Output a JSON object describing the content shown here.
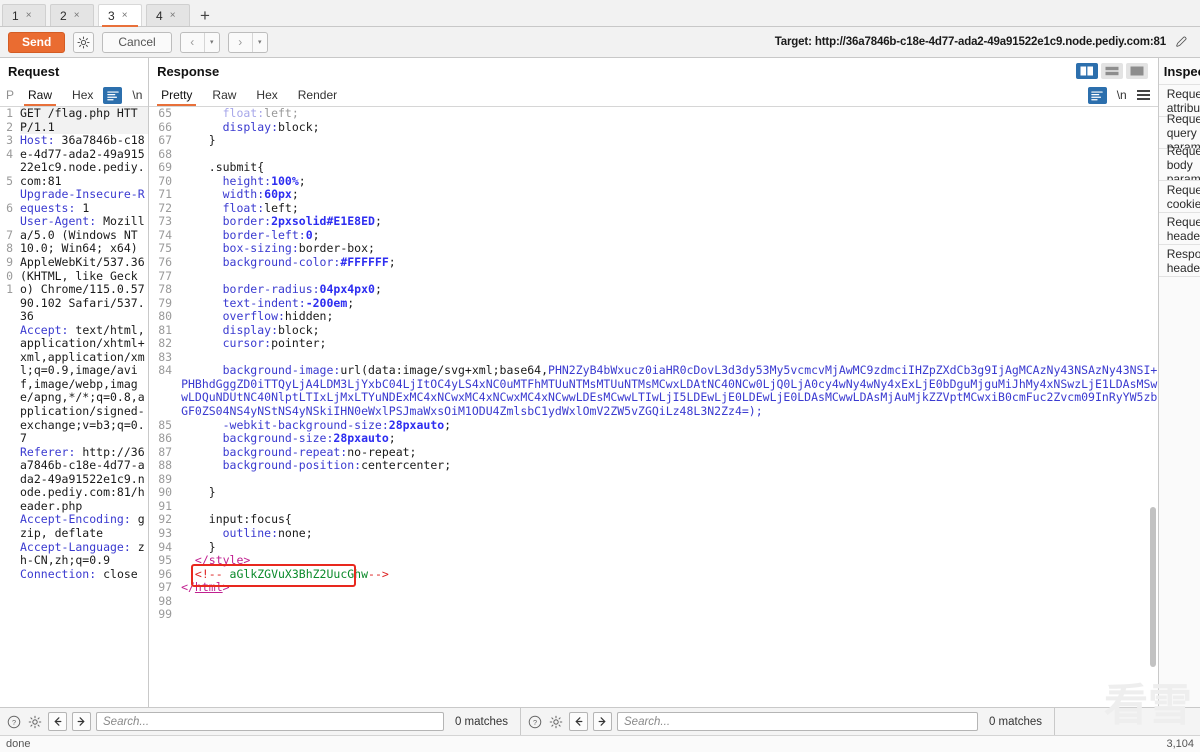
{
  "tabs": {
    "items": [
      {
        "label": "1",
        "close": "×",
        "active": false
      },
      {
        "label": "2",
        "close": "×",
        "active": false
      },
      {
        "label": "3",
        "close": "×",
        "active": true
      },
      {
        "label": "4",
        "close": "×",
        "active": false
      }
    ],
    "add_label": "+"
  },
  "actionbar": {
    "send_label": "Send",
    "settings_icon": "gear-icon",
    "cancel_label": "Cancel",
    "prev_label": "‹",
    "next_label": "›",
    "dropdown_caret": "▾",
    "target_label": "Target: http://36a7846b-c18e-4d77-ada2-49a91522e1c9.node.pediy.com:81",
    "edit_icon": "pencil-icon"
  },
  "request": {
    "title": "Request",
    "tabs": [
      {
        "label": "P",
        "active": false
      },
      {
        "label": "Raw",
        "active": true
      },
      {
        "label": "Hex",
        "active": false
      }
    ],
    "format_icon": "format-icon",
    "newline_label": "\\n",
    "menu_icon": "hamburger-icon",
    "lines": [
      {
        "n": "1",
        "kind": "request-line",
        "method": "GET",
        "path": "/flag.php",
        "version": "HTTP/1.1"
      },
      {
        "n": "2",
        "kind": "header",
        "key": "Host:",
        "value": " 36a7846b-c18e-4d77-ada2-49a91522e1c9.node.pediy.com:81"
      },
      {
        "n": "3",
        "kind": "header",
        "key": "Upgrade-Insecure-Requests:",
        "value": " 1"
      },
      {
        "n": "4",
        "kind": "header",
        "key": "User-Agent:",
        "value": " Mozilla/5.0 (Windows NT 10.0; Win64; x64) AppleWebKit/537.36 (KHTML, like Gecko) Chrome/115.0.5790.102 Safari/537.36"
      },
      {
        "n": "5",
        "kind": "header",
        "key": "Accept:",
        "value": " text/html,application/xhtml+xml,application/xml;q=0.9,image/avif,image/webp,image/apng,*/*;q=0.8,application/signed-exchange;v=b3;q=0.7"
      },
      {
        "n": "6",
        "kind": "header",
        "key": "Referer:",
        "value": " http://36a7846b-c18e-4d77-ada2-49a91522e1c9.node.pediy.com:81/header.php"
      },
      {
        "n": "7",
        "kind": "header",
        "key": "Accept-Encoding:",
        "value": " gzip, deflate"
      },
      {
        "n": "8",
        "kind": "header",
        "key": "Accept-Language:",
        "value": " zh-CN,zh;q=0.9"
      },
      {
        "n": "9",
        "kind": "header",
        "key": "Connection:",
        "value": " close"
      },
      {
        "n": "0",
        "kind": "blank",
        "key": "",
        "value": ""
      },
      {
        "n": "1",
        "kind": "blank",
        "key": "",
        "value": ""
      }
    ],
    "search": {
      "placeholder": "Search...",
      "matches": "0 matches",
      "help_icon": "help-icon",
      "settings_icon": "gear-icon",
      "prev_icon": "arrow-left-icon",
      "next_icon": "arrow-right-icon"
    }
  },
  "response": {
    "title": "Response",
    "tabs": [
      {
        "label": "Pretty",
        "active": true
      },
      {
        "label": "Raw",
        "active": false
      },
      {
        "label": "Hex",
        "active": false
      },
      {
        "label": "Render",
        "active": false
      }
    ],
    "layout_toggles": [
      {
        "name": "split-vertical-icon",
        "active": true
      },
      {
        "name": "split-horizontal-icon",
        "active": false
      },
      {
        "name": "single-pane-icon",
        "active": false
      }
    ],
    "format_icon": "format-icon",
    "newline_label": "\\n",
    "menu_icon": "hamburger-icon",
    "lines": [
      {
        "n": "65",
        "indent": 3,
        "text": "float:left;",
        "prop": "float",
        "value": "left",
        "style": "css",
        "clipped": true
      },
      {
        "n": "66",
        "indent": 3,
        "text": "display:block;",
        "prop": "display",
        "value": "block",
        "style": "css"
      },
      {
        "n": "67",
        "indent": 2,
        "text": "}",
        "style": "plain"
      },
      {
        "n": "68",
        "indent": 0,
        "text": "",
        "style": "plain"
      },
      {
        "n": "69",
        "indent": 2,
        "text": ".submit{",
        "style": "plain"
      },
      {
        "n": "70",
        "indent": 3,
        "text": "height:100%;",
        "prop": "height",
        "value": "100%",
        "style": "cssnum"
      },
      {
        "n": "71",
        "indent": 3,
        "text": "width:60px;",
        "prop": "width",
        "value": "60px",
        "style": "cssnum"
      },
      {
        "n": "72",
        "indent": 3,
        "text": "float:left;",
        "prop": "float",
        "value": "left",
        "style": "css"
      },
      {
        "n": "73",
        "indent": 3,
        "text": "border:2pxsolid#E1E8ED;",
        "prop": "border",
        "value": "2pxsolid#E1E8ED",
        "style": "cssnum"
      },
      {
        "n": "74",
        "indent": 3,
        "text": "border-left:0;",
        "prop": "border-left",
        "value": "0",
        "style": "cssnum"
      },
      {
        "n": "75",
        "indent": 3,
        "text": "box-sizing:border-box;",
        "prop": "box-sizing",
        "value": "border-box",
        "style": "css"
      },
      {
        "n": "76",
        "indent": 3,
        "text": "background-color:#FFFFFF;",
        "prop": "background-color",
        "value": "#FFFFFF",
        "style": "cssnum"
      },
      {
        "n": "77",
        "indent": 0,
        "text": "",
        "style": "plain"
      },
      {
        "n": "78",
        "indent": 3,
        "text": "border-radius:04px4px0;",
        "prop": "border-radius",
        "value": "04px4px0",
        "style": "cssnum"
      },
      {
        "n": "79",
        "indent": 3,
        "text": "text-indent:-200em;",
        "prop": "text-indent",
        "value": "-200em",
        "style": "cssnum"
      },
      {
        "n": "80",
        "indent": 3,
        "text": "overflow:hidden;",
        "prop": "overflow",
        "value": "hidden",
        "style": "css"
      },
      {
        "n": "81",
        "indent": 3,
        "text": "display:block;",
        "prop": "display",
        "value": "block",
        "style": "css"
      },
      {
        "n": "82",
        "indent": 3,
        "text": "cursor:pointer;",
        "prop": "cursor",
        "value": "pointer",
        "style": "css"
      },
      {
        "n": "83",
        "indent": 0,
        "text": "",
        "style": "plain"
      },
      {
        "n": "84",
        "indent": 3,
        "text": "background-image:url(data:image/svg+xml;base64,PHN2ZyB4bWxucz0iaHR0cDovL3d3dy53My5vcmcvMjAwMC9zdmciIHZpZXdCb3g9IjAgMCAzNy43NSAzNy43NSI+PHBhdGggZD0iTTQyLjA4LDM3LjYxbC04LjItOC4yLS4xNC0uMTFhMTUuNTMsMTUuNTMsMCwxLDAtNC40NCw0LjQ0LjA0cy4wNy4wNy4xExLjE0bDguMjguMiJhMy4xNSwzLjE1LDAsMSwwLDQuNDUtNC40NlptLTIxLjMxLTYuNDExMC4xNCwxMC4xNCwxMC4xNCwwLDEsMCwwLTIwLjI5LDEwLjE0LDEwLjE0LDAsMCwwLDAsMjAuMjkZZVptMCwxiB0cmFuc2Zvcm09InRyYW5zbGF0ZS04NS4yNStNS4yNSkiIHN0eWxlPSJmaWxsOiM1ODU4ZmlsbC1ydWxlOmV2ZW5vZGQiLz48L3N2Zz4=);",
        "style": "b64"
      },
      {
        "n": "85",
        "indent": 3,
        "text": "-webkit-background-size:28pxauto;",
        "prop": "-webkit-background-size",
        "value": "28pxauto",
        "style": "cssnum"
      },
      {
        "n": "86",
        "indent": 3,
        "text": "background-size:28pxauto;",
        "prop": "background-size",
        "value": "28pxauto",
        "style": "cssnum"
      },
      {
        "n": "87",
        "indent": 3,
        "text": "background-repeat:no-repeat;",
        "prop": "background-repeat",
        "value": "no-repeat",
        "style": "css"
      },
      {
        "n": "88",
        "indent": 3,
        "text": "background-position:centercenter;",
        "prop": "background-position",
        "value": "centercenter",
        "style": "css"
      },
      {
        "n": "89",
        "indent": 0,
        "text": "",
        "style": "plain"
      },
      {
        "n": "90",
        "indent": 2,
        "text": "}",
        "style": "plain"
      },
      {
        "n": "91",
        "indent": 0,
        "text": "",
        "style": "plain"
      },
      {
        "n": "92",
        "indent": 2,
        "text": "input:focus{",
        "style": "plain"
      },
      {
        "n": "93",
        "indent": 3,
        "text": "outline:none;",
        "prop": "outline",
        "value": "none",
        "style": "css"
      },
      {
        "n": "94",
        "indent": 2,
        "text": "}",
        "style": "plain"
      },
      {
        "n": "95",
        "indent": 1,
        "text": "</style>",
        "style": "closetag",
        "tagname": "style"
      },
      {
        "n": "96",
        "indent": 1,
        "text": "<!-- aGlkZGVuX3BhZ2UucGhw-->",
        "style": "comment",
        "comment_open": "<!--",
        "flag": " aGlkZGVuX3BhZ2UucGhw",
        "comment_close": "-->"
      },
      {
        "n": "97",
        "indent": 0,
        "text": "</html>",
        "style": "closetag",
        "tagname": "html"
      },
      {
        "n": "98",
        "indent": 0,
        "text": "",
        "style": "plain"
      },
      {
        "n": "99",
        "indent": 0,
        "text": "",
        "style": "plain"
      }
    ],
    "search": {
      "placeholder": "Search...",
      "matches": "0 matches",
      "help_icon": "help-icon",
      "settings_icon": "gear-icon",
      "prev_icon": "arrow-left-icon",
      "next_icon": "arrow-right-icon"
    }
  },
  "inspector": {
    "title": "Inspector",
    "toggles": [
      {
        "name": "inspector-collapse-icon",
        "active": false
      },
      {
        "name": "inspector-expand-icon",
        "active": true
      }
    ],
    "menu_icon": "hamburger-icon",
    "items": [
      {
        "label": "Request attributes"
      },
      {
        "label": "Request query parameters"
      },
      {
        "label": "Request body parameters"
      },
      {
        "label": "Request cookies"
      },
      {
        "label": "Request headers"
      },
      {
        "label": "Response headers"
      }
    ]
  },
  "statusbar": {
    "left_text": "done",
    "right_text": "3,104"
  },
  "watermark": {
    "text": "看雪"
  },
  "colors": {
    "accent_orange": "#ea6c31",
    "accent_blue": "#2c6fad",
    "flag_highlight": "#0a8a2a",
    "flag_box": "#e8281e",
    "header_key": "#3a3ad0",
    "css_value_num": "#2d2df0",
    "tag": "#c02090"
  }
}
